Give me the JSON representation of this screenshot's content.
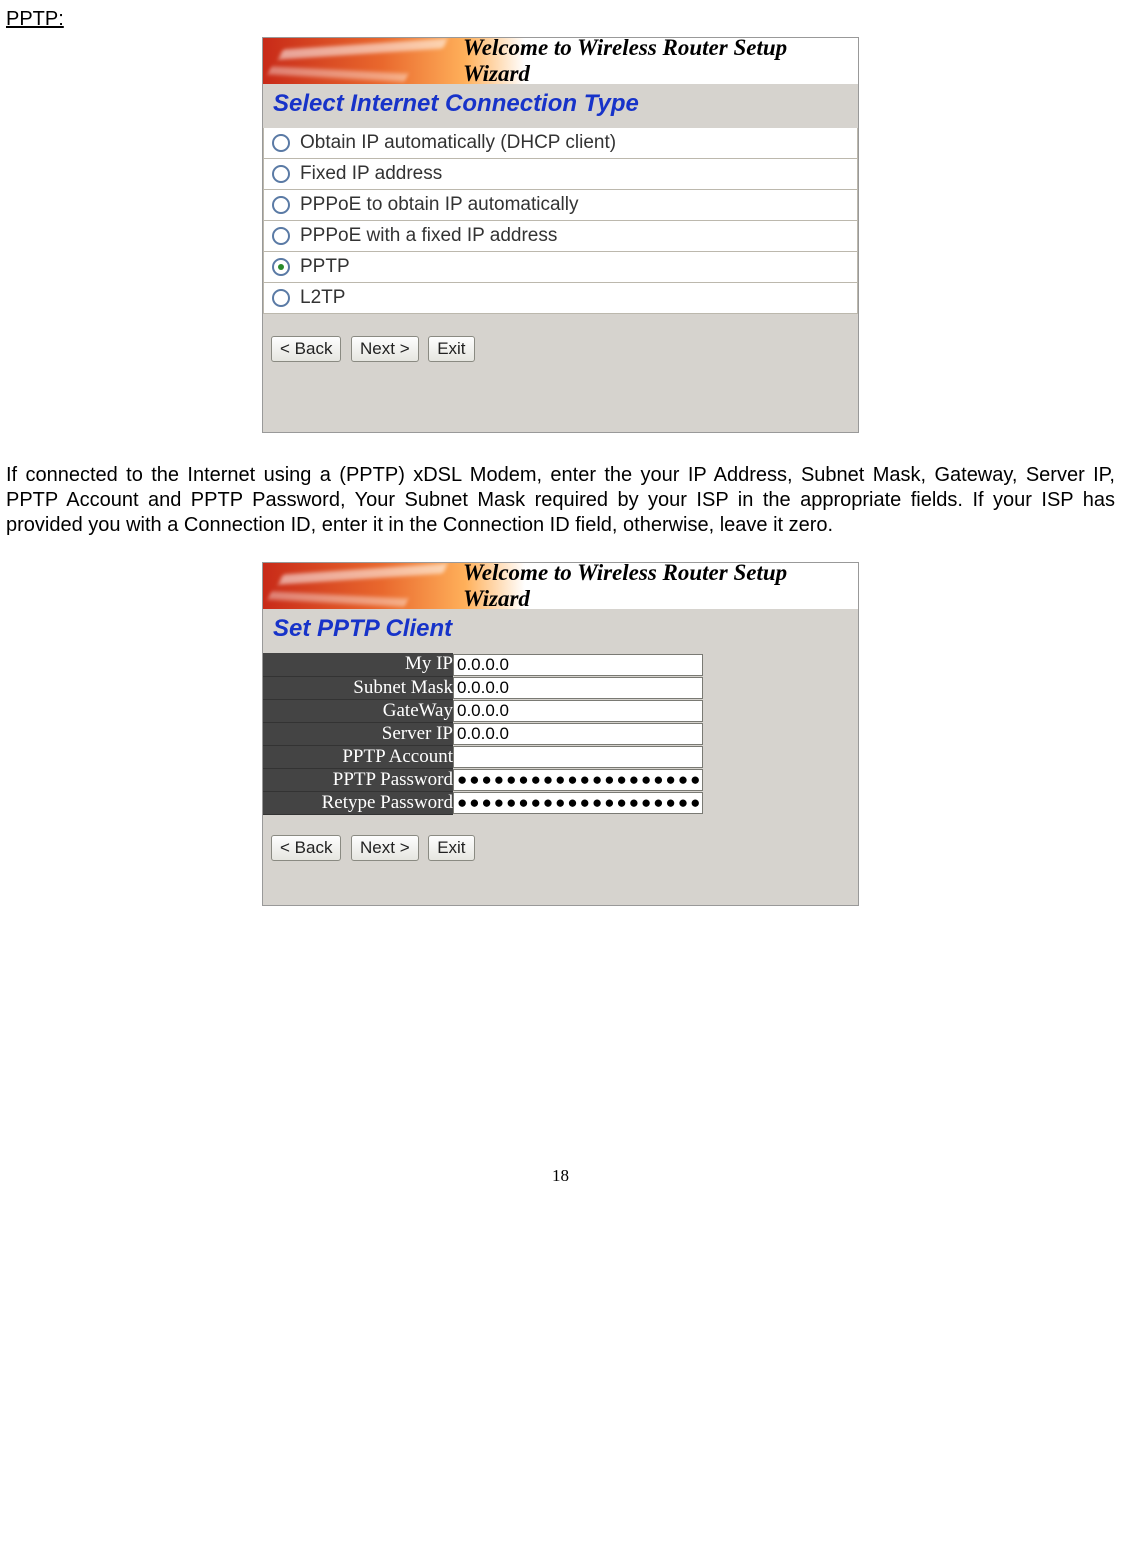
{
  "heading": "PPTP:",
  "wizard1": {
    "banner": "Welcome to Wireless Router Setup Wizard",
    "title": "Select Internet Connection Type",
    "options": [
      {
        "label": "Obtain IP automatically (DHCP client)",
        "checked": false
      },
      {
        "label": "Fixed IP address",
        "checked": false
      },
      {
        "label": "PPPoE to obtain IP automatically",
        "checked": false
      },
      {
        "label": "PPPoE with a fixed IP address",
        "checked": false
      },
      {
        "label": "PPTP",
        "checked": true
      },
      {
        "label": "L2TP",
        "checked": false
      }
    ],
    "buttons": {
      "back": "< Back",
      "next": "Next >",
      "exit": "Exit"
    }
  },
  "paragraph": "If connected to the Internet using a (PPTP) xDSL Modem, enter the your IP Address, Subnet Mask, Gateway, Server IP, PPTP Account and PPTP Password, Your Subnet Mask required by your ISP in the appropriate fields. If your ISP has provided you with a Connection ID, enter it in the Connection ID field, otherwise, leave it zero.",
  "wizard2": {
    "banner": "Welcome to Wireless Router Setup Wizard",
    "title": "Set PPTP Client",
    "fields": {
      "my_ip": {
        "label": "My IP",
        "value": "0.0.0.0"
      },
      "subnet_mask": {
        "label": "Subnet Mask",
        "value": "0.0.0.0"
      },
      "gateway": {
        "label": "GateWay",
        "value": "0.0.0.0"
      },
      "server_ip": {
        "label": "Server IP",
        "value": "0.0.0.0"
      },
      "pptp_account": {
        "label": "PPTP Account",
        "value": ""
      },
      "pptp_password": {
        "label": "PPTP Password",
        "value": "●●●●●●●●●●●●●●●●●●●●●●●●●"
      },
      "retype_pwd": {
        "label": "Retype Password",
        "value": "●●●●●●●●●●●●●●●●●●●●●●●●●"
      }
    },
    "buttons": {
      "back": "< Back",
      "next": "Next >",
      "exit": "Exit"
    }
  },
  "page_number": "18"
}
